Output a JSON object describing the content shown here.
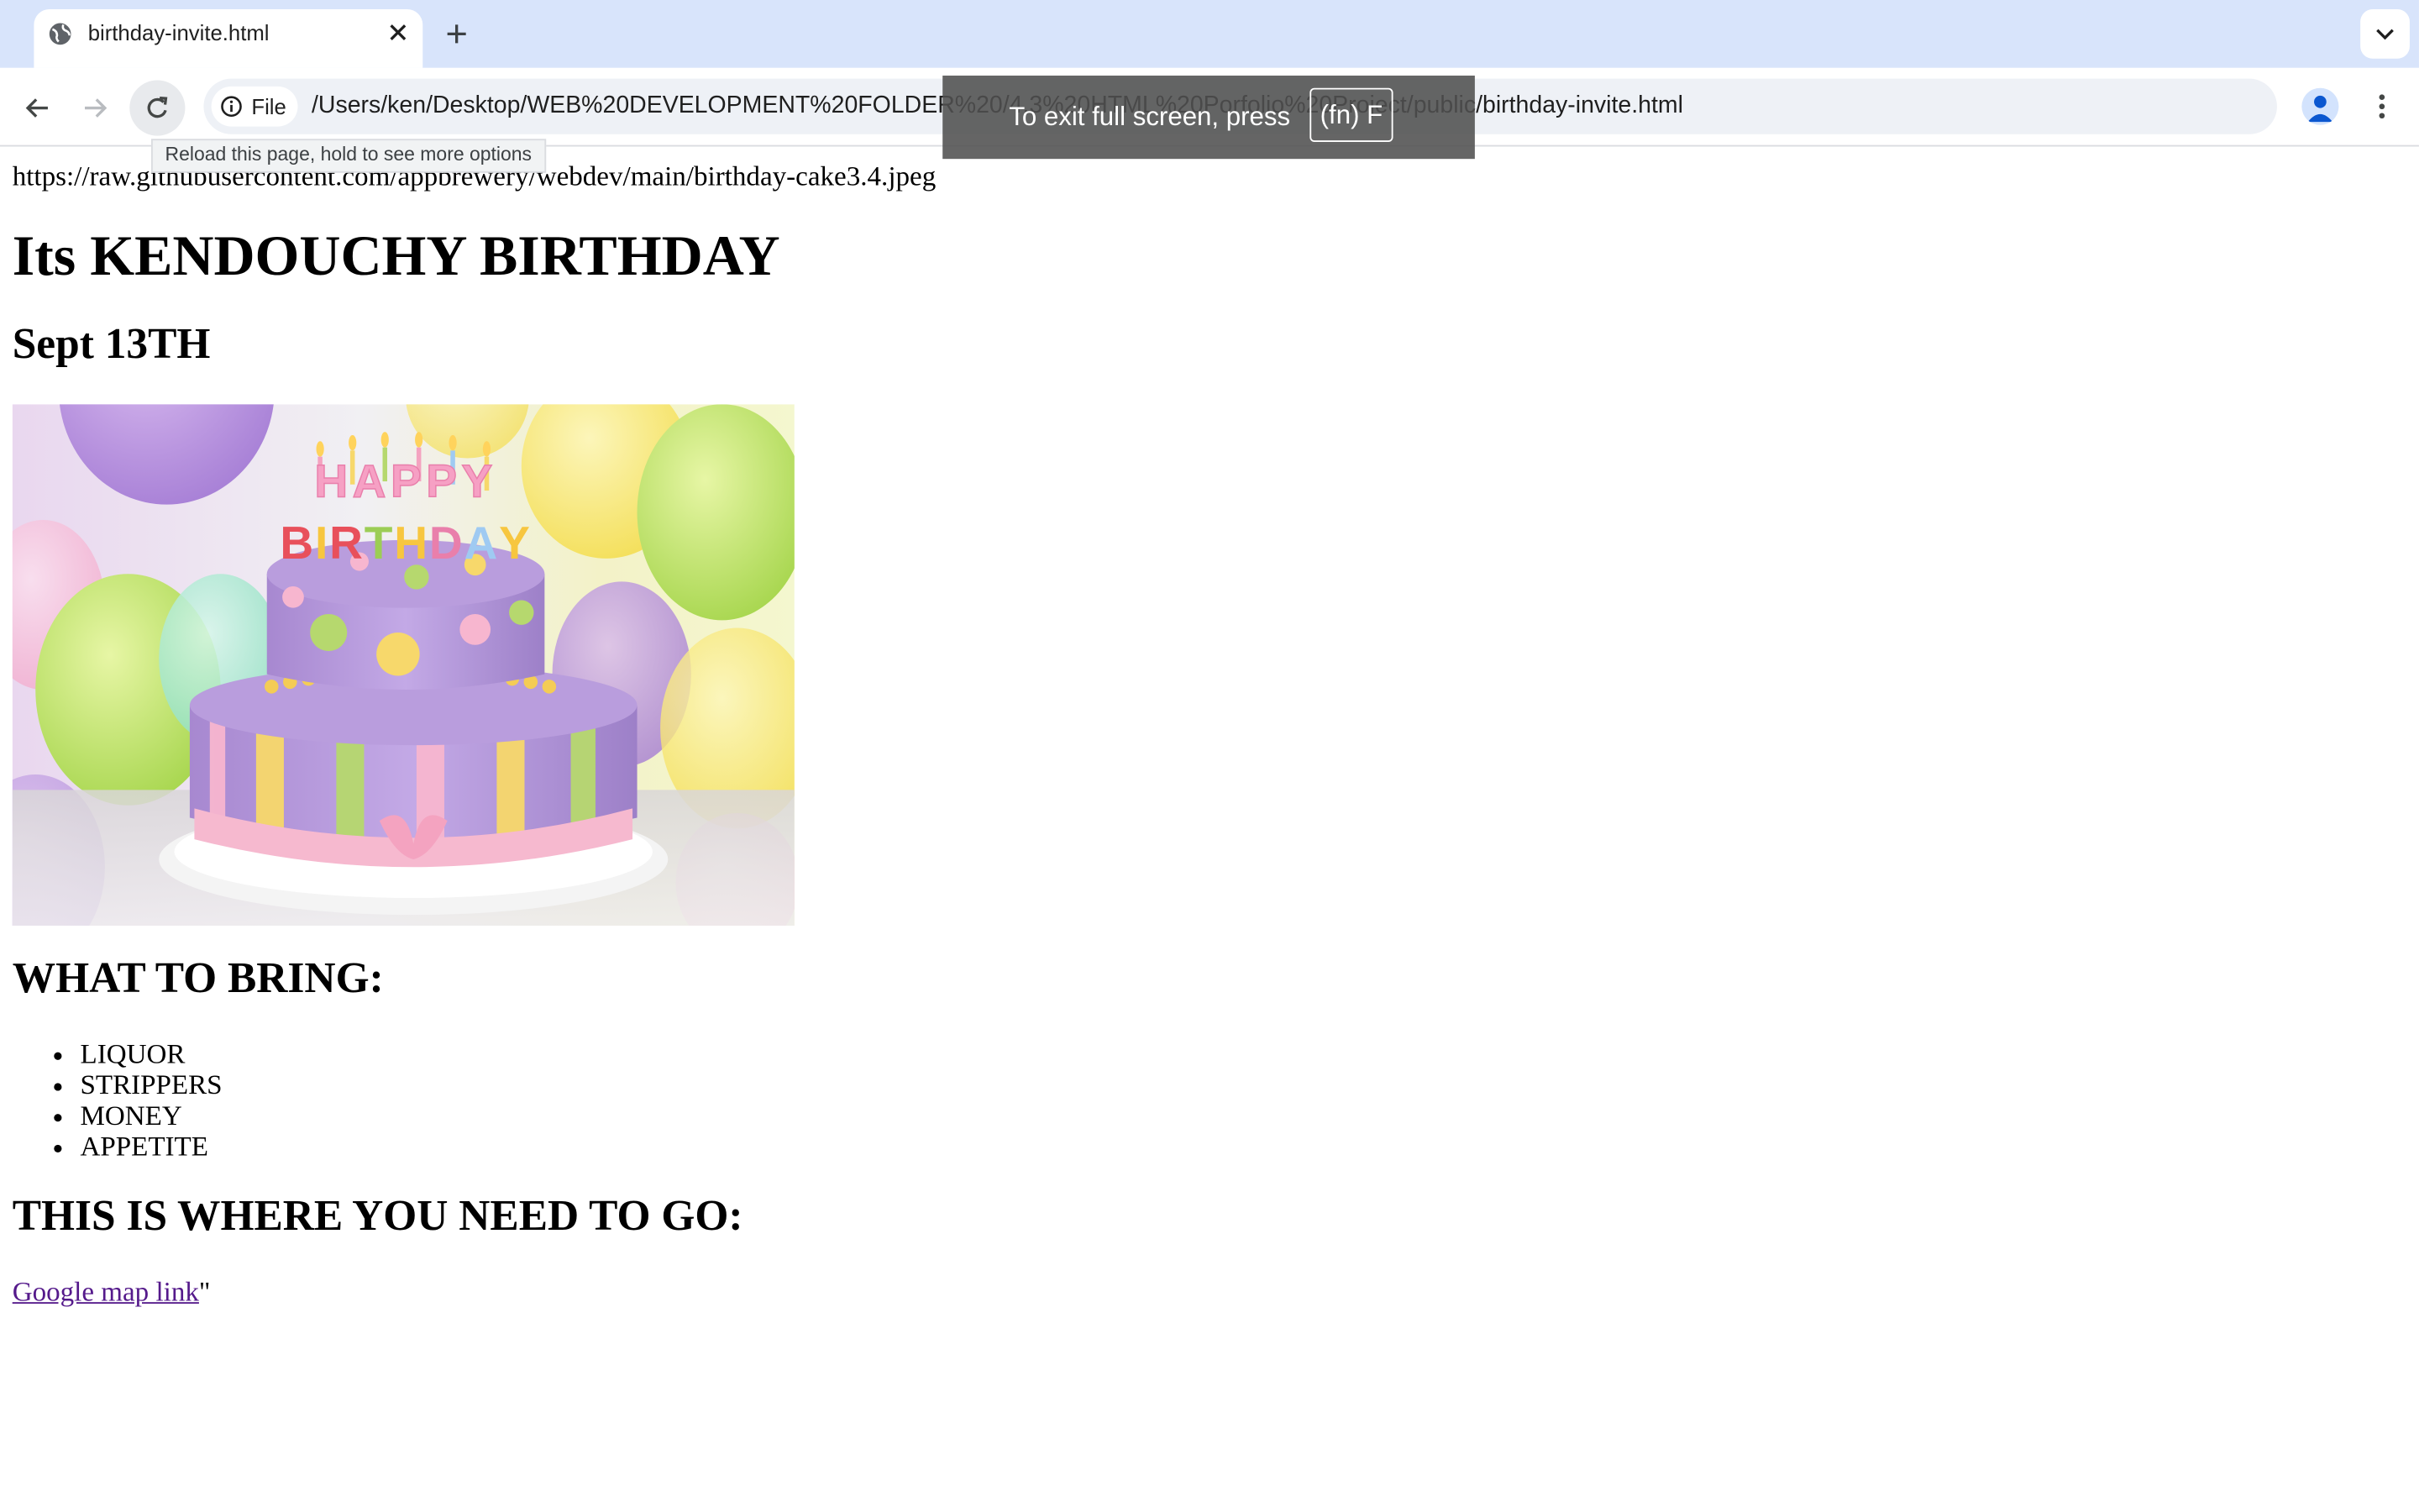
{
  "browser": {
    "tab_title": "birthday-invite.html",
    "chip_label": "File",
    "url": "/Users/ken/Desktop/WEB%20DEVELOPMENT%20FOLDER%20/4.3%20HTML%20Porfolio%20Project/public/birthday-invite.html",
    "tooltip": "Reload this page, hold to see more options",
    "fullscreen_message": "To exit full screen, press",
    "fullscreen_key": "(fn) F"
  },
  "page": {
    "image_url_text": "https://raw.githubusercontent.com/appbrewery/webdev/main/birthday-cake3.4.jpeg",
    "title": "Its KENDOUCHY BIRTHDAY",
    "date": "Sept 13TH",
    "bring_heading": "WHAT TO BRING:",
    "bring_items": [
      "LIQUOR",
      "STRIPPERS",
      "MONEY",
      "APPETITE"
    ],
    "where_heading": "THIS IS WHERE YOU NEED TO GO:",
    "map_link": "Google map link",
    "trailing_quote": "\"",
    "cake_topper_text": "HAPPY BIRTHDAY"
  },
  "colors": {
    "tabstrip": "#d8e4fb",
    "visited_link": "#551a8b",
    "toast": "#505050"
  }
}
